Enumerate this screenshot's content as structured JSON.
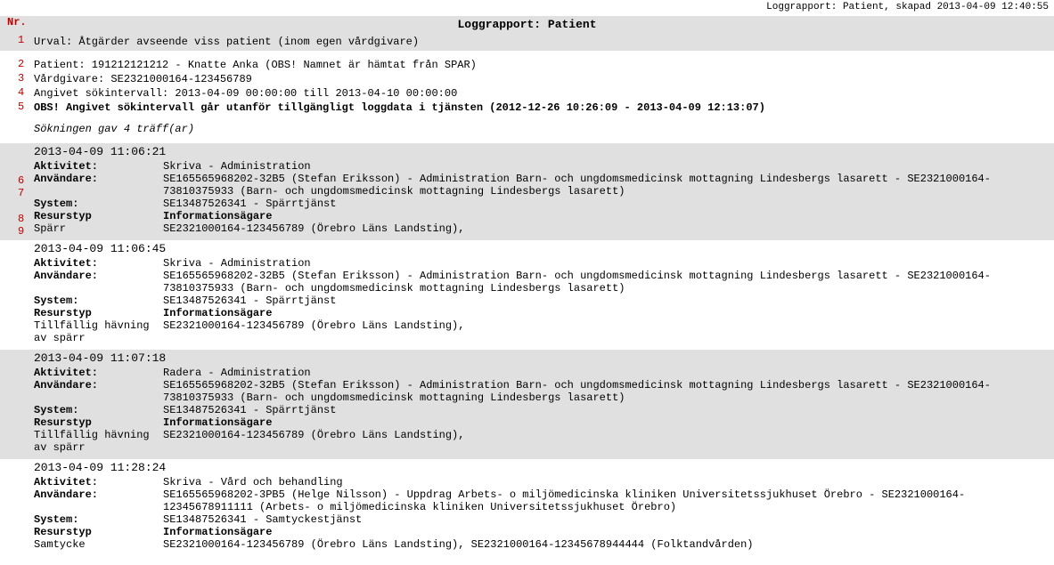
{
  "top_right": "Loggrapport: Patient, skapad 2013-04-09 12:40:55",
  "title": "Loggrapport: Patient",
  "nr_label": "Nr.",
  "annotations": [
    "1",
    "2",
    "3",
    "4",
    "5",
    "6",
    "7",
    "8",
    "9"
  ],
  "urval": "Urval: Åtgärder avseende viss patient (inom egen vårdgivare)",
  "patient": "Patient: 191212121212 - Knatte Anka (OBS! Namnet är hämtat från SPAR)",
  "vardgivare": "Vårdgivare: SE2321000164-123456789",
  "interval": "Angivet sökintervall: 2013-04-09 00:00:00 till 2013-04-10 00:00:00",
  "obs": "OBS! Angivet sökintervall går utanför tillgängligt loggdata i tjänsten (2012-12-26 10:26:09 - 2013-04-09 12:13:07)",
  "hits": "Sökningen gav 4 träff(ar)",
  "fieldLabels": {
    "aktivitet": "Aktivitet:",
    "anvandare": "Användare:",
    "system": "System:",
    "resurstyp": "Resurstyp",
    "infoagare": "Informationsägare"
  },
  "entries": [
    {
      "shaded": true,
      "ts": "2013-04-09 11:06:21",
      "aktivitet": "Skriva - Administration",
      "anvandare": "SE165565968202-32B5 (Stefan Eriksson) - Administration Barn- och ungdomsmedicinsk mottagning Lindesbergs lasarett - SE2321000164-73810375933 (Barn- och ungdomsmedicinsk mottagning Lindesbergs lasarett)",
      "system": "SE13487526341 - Spärrtjänst",
      "resource_label": "Spärr",
      "resource_value": "SE2321000164-123456789 (Örebro Läns Landsting),"
    },
    {
      "shaded": false,
      "ts": "2013-04-09 11:06:45",
      "aktivitet": "Skriva - Administration",
      "anvandare": "SE165565968202-32B5 (Stefan Eriksson) - Administration Barn- och ungdomsmedicinsk mottagning Lindesbergs lasarett - SE2321000164-73810375933 (Barn- och ungdomsmedicinsk mottagning Lindesbergs lasarett)",
      "system": "SE13487526341 - Spärrtjänst",
      "resource_label": "Tillfällig hävning av spärr",
      "resource_value": "SE2321000164-123456789 (Örebro Läns Landsting),"
    },
    {
      "shaded": true,
      "ts": "2013-04-09 11:07:18",
      "aktivitet": "Radera - Administration",
      "anvandare": "SE165565968202-32B5 (Stefan Eriksson) - Administration Barn- och ungdomsmedicinsk mottagning Lindesbergs lasarett - SE2321000164-73810375933 (Barn- och ungdomsmedicinsk mottagning Lindesbergs lasarett)",
      "system": "SE13487526341 - Spärrtjänst",
      "resource_label": "Tillfällig hävning av spärr",
      "resource_value": "SE2321000164-123456789 (Örebro Läns Landsting),"
    },
    {
      "shaded": false,
      "ts": "2013-04-09 11:28:24",
      "aktivitet": "Skriva - Vård och behandling",
      "anvandare": "SE165565968202-3PB5 (Helge Nilsson) - Uppdrag Arbets- o miljömedicinska kliniken Universitetssjukhuset Örebro - SE2321000164-12345678911111 (Arbets- o miljömedicinska kliniken Universitetssjukhuset Örebro)",
      "system": "SE13487526341 - Samtyckestjänst",
      "resource_label": "Samtycke",
      "resource_value": "SE2321000164-123456789 (Örebro Läns Landsting), SE2321000164-12345678944444 (Folktandvården)"
    }
  ]
}
